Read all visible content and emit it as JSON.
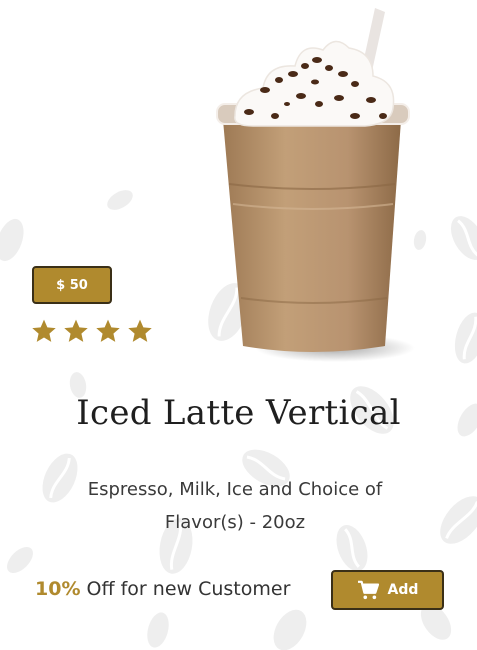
{
  "product": {
    "price": "$ 50",
    "rating_stars": 4,
    "title": "Iced Latte Vertical",
    "description_line1": "Espresso, Milk, Ice and Choice of",
    "description_line2": "Flavor(s) - 20oz",
    "promo_percent": "10%",
    "promo_text": " Off for new Customer",
    "add_label": "Add",
    "image_icon": "iced-latte-image",
    "cart_icon": "shopping-cart-icon"
  },
  "colors": {
    "accent": "#b08a2e",
    "button_border": "#3a2f17",
    "bean_pattern": "#efefef"
  }
}
